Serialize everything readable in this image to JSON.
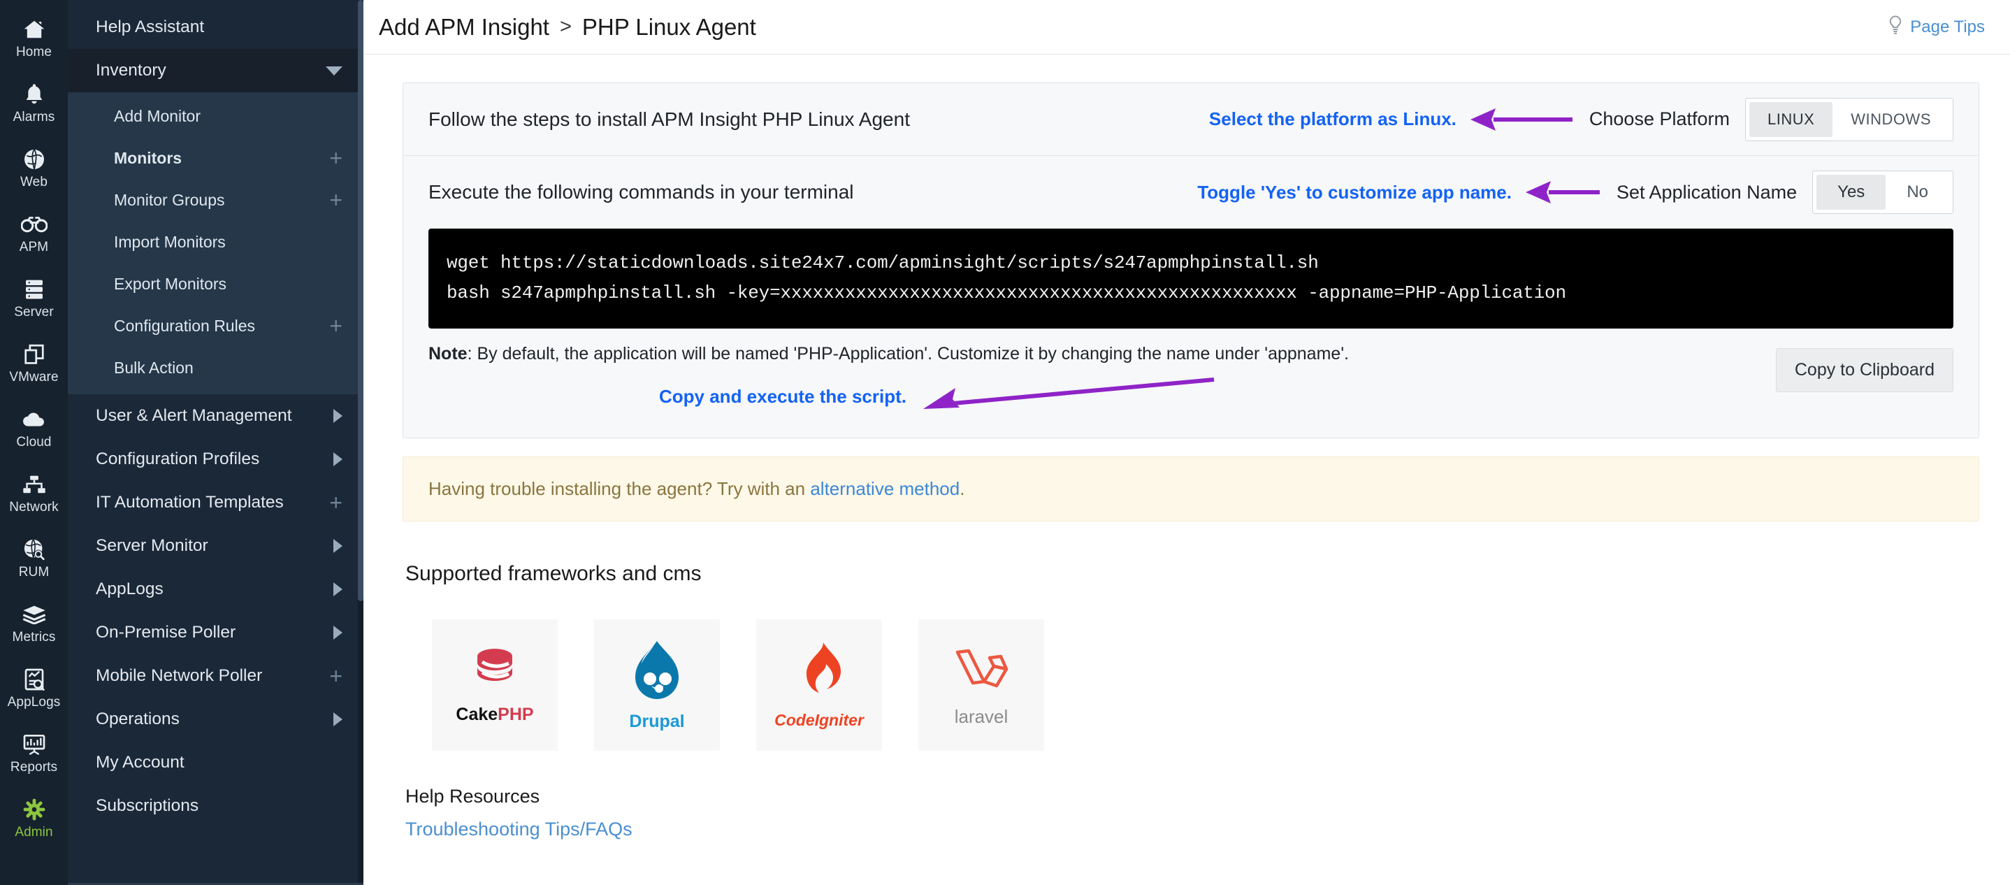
{
  "rail": {
    "items": [
      {
        "label": "Home",
        "icon": "home-icon",
        "active": false
      },
      {
        "label": "Alarms",
        "icon": "bell-icon",
        "active": false
      },
      {
        "label": "Web",
        "icon": "globe-icon",
        "active": false
      },
      {
        "label": "APM",
        "icon": "binoculars-icon",
        "active": false
      },
      {
        "label": "Server",
        "icon": "server-icon",
        "active": false
      },
      {
        "label": "VMware",
        "icon": "vmware-icon",
        "active": false
      },
      {
        "label": "Cloud",
        "icon": "cloud-icon",
        "active": false
      },
      {
        "label": "Network",
        "icon": "network-icon",
        "active": false
      },
      {
        "label": "RUM",
        "icon": "rum-globe-icon",
        "active": false
      },
      {
        "label": "Metrics",
        "icon": "layers-icon",
        "active": false
      },
      {
        "label": "AppLogs",
        "icon": "applogs-icon",
        "active": false
      },
      {
        "label": "Reports",
        "icon": "reports-icon",
        "active": false
      },
      {
        "label": "Admin",
        "icon": "gear-icon",
        "active": true
      }
    ]
  },
  "sidemenu": {
    "help_assistant": "Help Assistant",
    "inventory": "Inventory",
    "sub_items": [
      {
        "label": "Add Monitor",
        "bold": false,
        "plus": false
      },
      {
        "label": "Monitors",
        "bold": true,
        "plus": true
      },
      {
        "label": "Monitor Groups",
        "bold": false,
        "plus": true
      },
      {
        "label": "Import Monitors",
        "bold": false,
        "plus": false
      },
      {
        "label": "Export Monitors",
        "bold": false,
        "plus": false
      },
      {
        "label": "Configuration Rules",
        "bold": false,
        "plus": true
      },
      {
        "label": "Bulk Action",
        "bold": false,
        "plus": false
      }
    ],
    "items": [
      {
        "label": "User & Alert Management",
        "arrow": true,
        "plus": false
      },
      {
        "label": "Configuration Profiles",
        "arrow": true,
        "plus": false
      },
      {
        "label": "IT Automation Templates",
        "arrow": false,
        "plus": true
      },
      {
        "label": "Server Monitor",
        "arrow": true,
        "plus": false
      },
      {
        "label": "AppLogs",
        "arrow": true,
        "plus": false
      },
      {
        "label": "On-Premise Poller",
        "arrow": true,
        "plus": false
      },
      {
        "label": "Mobile Network Poller",
        "arrow": false,
        "plus": true
      },
      {
        "label": "Operations",
        "arrow": true,
        "plus": false
      },
      {
        "label": "My Account",
        "arrow": false,
        "plus": false
      },
      {
        "label": "Subscriptions",
        "arrow": false,
        "plus": false
      }
    ]
  },
  "topbar": {
    "breadcrumb_root": "Add APM Insight",
    "breadcrumb_sep": ">",
    "breadcrumb_current": "PHP Linux Agent",
    "page_tips": "Page Tips",
    "page_tips_icon": "lightbulb-icon"
  },
  "install": {
    "step1_text": "Follow the steps to install APM Insight PHP Linux Agent",
    "step1_annotation": "Select the platform as Linux.",
    "platform_label": "Choose Platform",
    "platform_options": [
      "LINUX",
      "WINDOWS"
    ],
    "platform_selected": "LINUX",
    "step2_text": "Execute the following commands in your terminal",
    "step2_annotation": "Toggle 'Yes' to customize app name.",
    "appname_label": "Set Application Name",
    "appname_options": [
      "Yes",
      "No"
    ],
    "appname_selected": "Yes",
    "command_line_1": "wget https://staticdownloads.site24x7.com/apminsight/scripts/s247apmphpinstall.sh",
    "command_line_2": "bash s247apmphpinstall.sh -key=xxxxxxxxxxxxxxxxxxxxxxxxxxxxxxxxxxxxxxxxxxxxxxxx -appname=PHP-Application",
    "note_label": "Note",
    "note_text": ": By default, the application will be named 'PHP-Application'. Customize it by changing the name under 'appname'.",
    "note_annotation": "Copy and execute the script.",
    "copy_button": "Copy to Clipboard"
  },
  "banner": {
    "text_before": "Having trouble installing the agent? Try with an ",
    "link": "alternative method",
    "text_after": "."
  },
  "frameworks": {
    "title": "Supported frameworks and cms",
    "items": [
      {
        "name": "CakePHP",
        "icon": "cakephp-logo"
      },
      {
        "name": "Drupal",
        "icon": "drupal-logo"
      },
      {
        "name": "CodeIgniter",
        "icon": "codeigniter-logo"
      },
      {
        "name": "laravel",
        "icon": "laravel-logo"
      }
    ]
  },
  "help": {
    "title": "Help Resources",
    "link": "Troubleshooting Tips/FAQs"
  },
  "colors": {
    "annotation_blue": "#1362f5",
    "arrow_purple": "#8e24c7",
    "link_blue": "#4a8fd0",
    "admin_green": "#8dc63f",
    "banner_bg": "#fdf8e7"
  }
}
